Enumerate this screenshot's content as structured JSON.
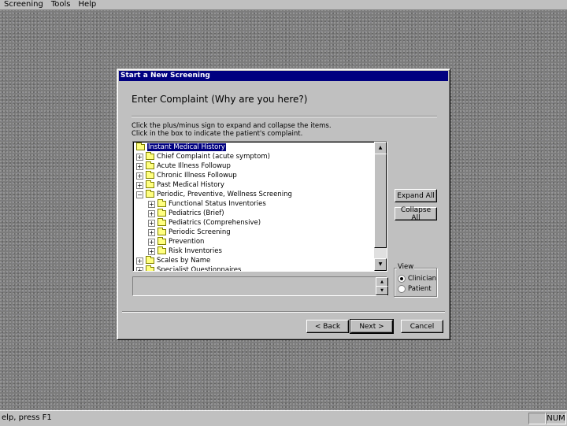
{
  "menu": {
    "items": [
      "Screening",
      "Tools",
      "Help"
    ]
  },
  "dialog": {
    "title": "Start a New Screening",
    "heading": "Enter Complaint (Why are you here?)",
    "instruction_1": "Click the plus/minus sign to expand and collapse the items.",
    "instruction_2": "Click in the box to indicate the patient's complaint.",
    "tree": [
      {
        "label": "Instant Medical History",
        "level": 0,
        "expander": "",
        "selected": true
      },
      {
        "label": "Chief Complaint (acute symptom)",
        "level": 1,
        "expander": "+"
      },
      {
        "label": "Acute Illness Followup",
        "level": 1,
        "expander": "+"
      },
      {
        "label": "Chronic Illness Followup",
        "level": 1,
        "expander": "+"
      },
      {
        "label": "Past Medical History",
        "level": 1,
        "expander": "+"
      },
      {
        "label": "Periodic, Preventive, Wellness Screening",
        "level": 1,
        "expander": "−"
      },
      {
        "label": "Functional Status Inventories",
        "level": 2,
        "expander": "+"
      },
      {
        "label": "Pediatrics (Brief)",
        "level": 2,
        "expander": "+"
      },
      {
        "label": "Pediatrics (Comprehensive)",
        "level": 2,
        "expander": "+"
      },
      {
        "label": "Periodic Screening",
        "level": 2,
        "expander": "+"
      },
      {
        "label": "Prevention",
        "level": 2,
        "expander": "+"
      },
      {
        "label": "Risk Inventories",
        "level": 2,
        "expander": "+"
      },
      {
        "label": "Scales by Name",
        "level": 1,
        "expander": "+"
      },
      {
        "label": "Specialist Questionnaires",
        "level": 1,
        "expander": "+"
      }
    ],
    "expand_all": "Expand All",
    "collapse_all": "Collapse All",
    "view": {
      "title": "View",
      "options": [
        "Clinician",
        "Patient"
      ],
      "selected": 0
    },
    "back": "< Back",
    "next": "Next >",
    "cancel": "Cancel"
  },
  "status": {
    "message": "elp, press F1",
    "indicator": "NUM"
  },
  "colors": {
    "titlebar": "#000080",
    "face": "#c0c0c0",
    "selection": "#000080"
  }
}
